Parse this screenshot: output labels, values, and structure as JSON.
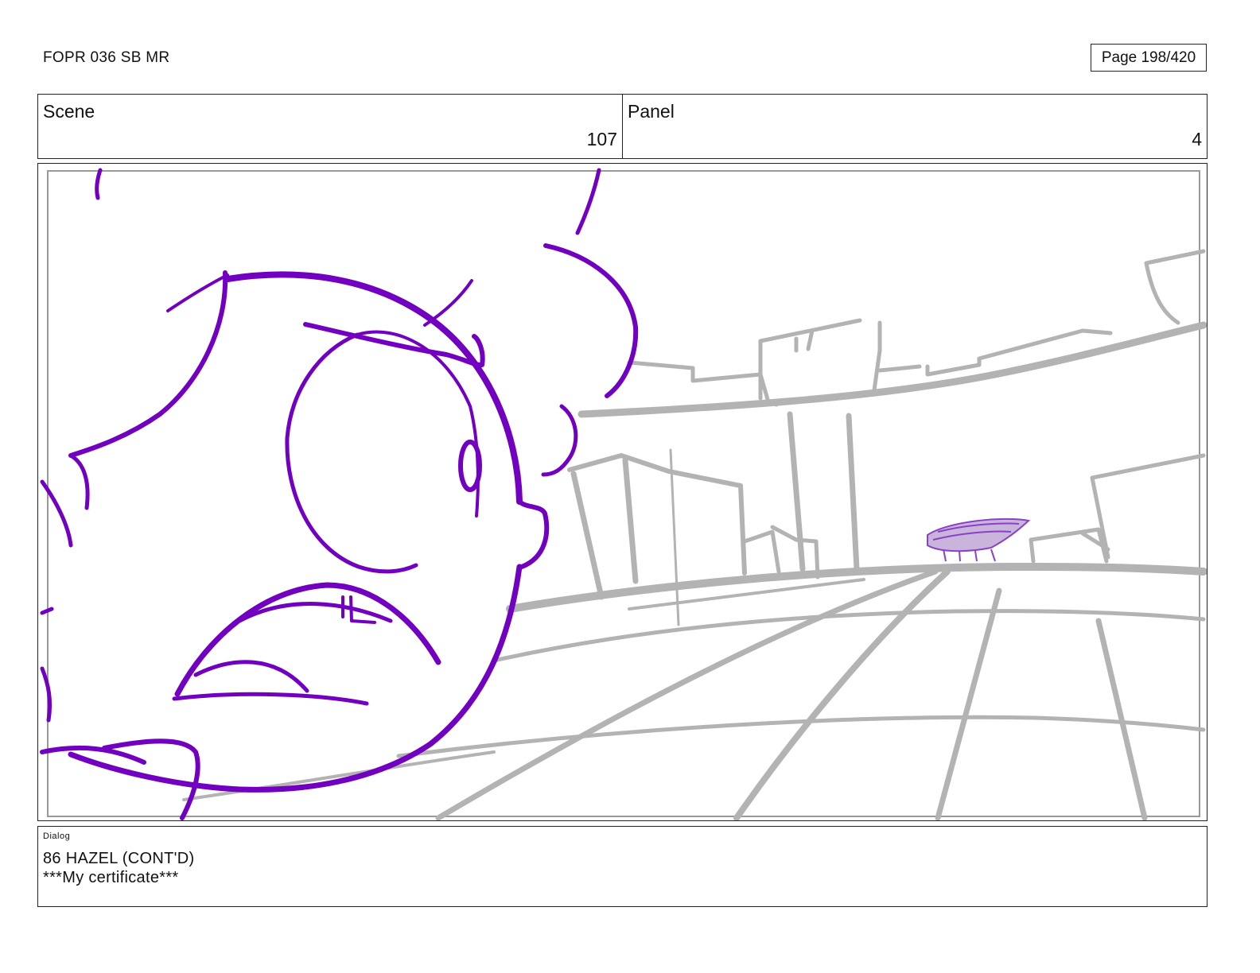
{
  "header": {
    "doc_title": "FOPR 036 SB MR",
    "page_label": "Page 198/420"
  },
  "info": {
    "scene_label": "Scene",
    "scene_value": "107",
    "panel_label": "Panel",
    "panel_value": "4"
  },
  "dialog": {
    "label": "Dialog",
    "lines": [
      "86 HAZEL (CONT'D)",
      "***My certificate***"
    ]
  },
  "colors": {
    "character_line": "#7100c0",
    "background_line": "#b3b3b3",
    "frame_border": "#222222"
  }
}
